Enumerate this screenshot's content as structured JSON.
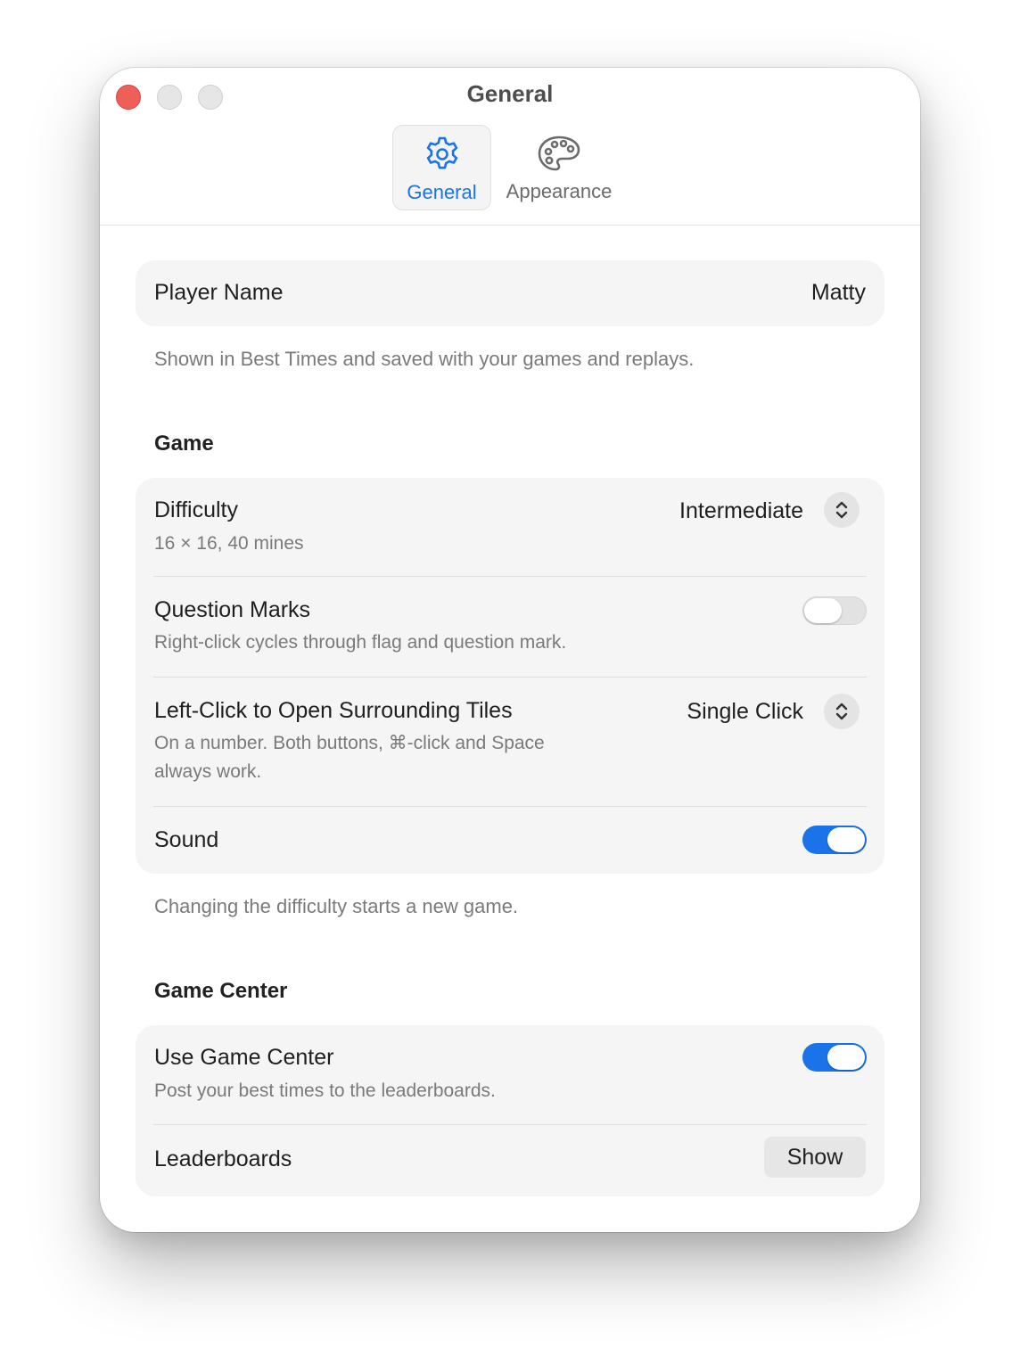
{
  "window": {
    "title": "General"
  },
  "tabs": [
    {
      "label": "General",
      "icon": "gear-icon",
      "selected": true
    },
    {
      "label": "Appearance",
      "icon": "palette-icon",
      "selected": false
    }
  ],
  "player": {
    "label": "Player Name",
    "value": "Matty",
    "footnote": "Shown in Best Times and saved with your games and replays."
  },
  "game": {
    "section_title": "Game",
    "difficulty": {
      "label": "Difficulty",
      "sub": "16 × 16, 40 mines",
      "value": "Intermediate"
    },
    "question_marks": {
      "label": "Question Marks",
      "sub": "Right-click cycles through flag and question mark.",
      "enabled": false
    },
    "left_click": {
      "label": "Left-Click to Open Surrounding Tiles",
      "sub_line1": "On a number. Both buttons, ⌘-click and Space",
      "sub_line2": "always work.",
      "value": "Single Click"
    },
    "sound": {
      "label": "Sound",
      "enabled": true
    },
    "footnote": "Changing the difficulty starts a new game."
  },
  "game_center": {
    "section_title": "Game Center",
    "use": {
      "label": "Use Game Center",
      "sub": "Post your best times to the leaderboards.",
      "enabled": true
    },
    "leaderboards": {
      "label": "Leaderboards",
      "button": "Show"
    }
  },
  "colors": {
    "accent": "#1a73e8",
    "close": "#ee5f57",
    "group_bg": "#f5f5f5"
  }
}
